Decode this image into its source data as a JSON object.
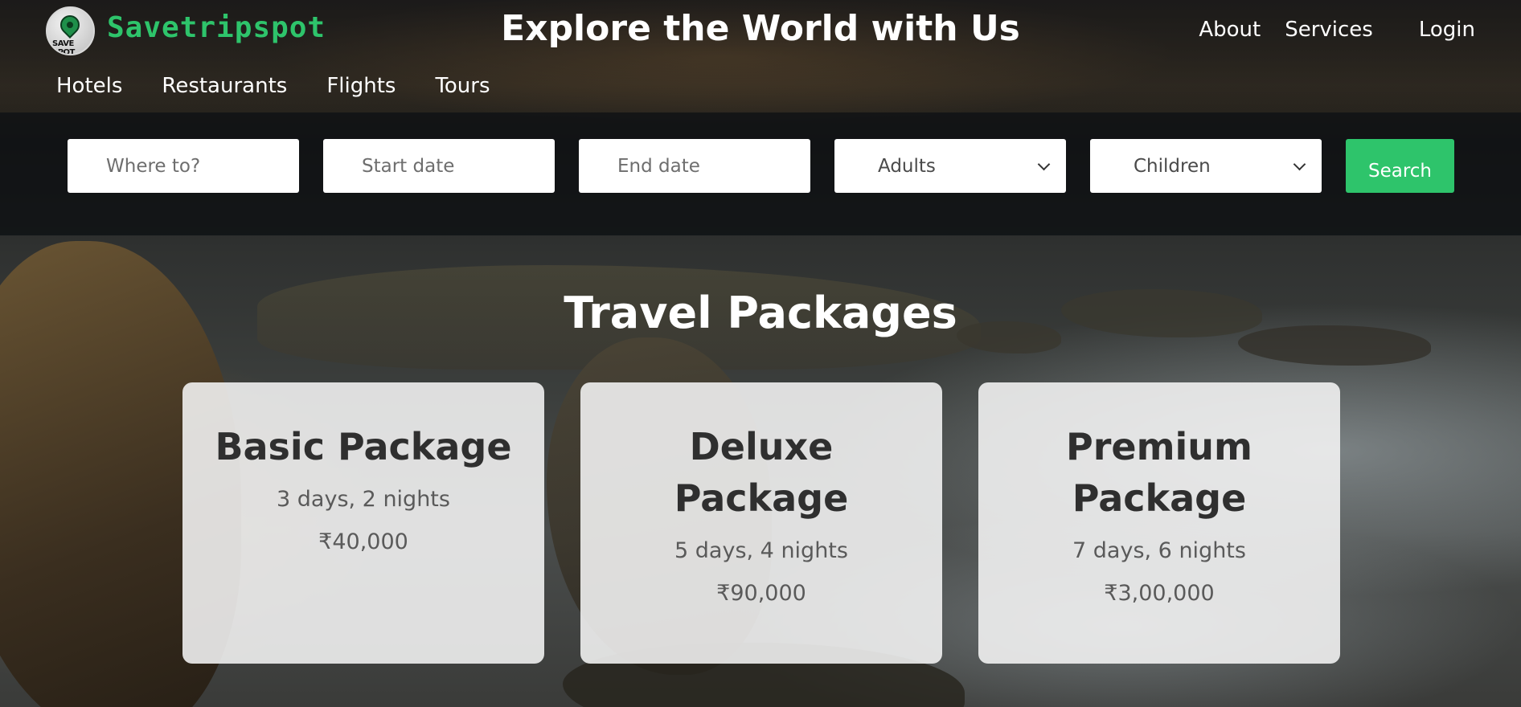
{
  "brand": {
    "name": "Savetripspot",
    "logo_text": "SAVE SPOT"
  },
  "header": {
    "title": "Explore the World with Us",
    "links": {
      "about": "About",
      "services": "Services",
      "login": "Login"
    },
    "subnav": [
      "Hotels",
      "Restaurants",
      "Flights",
      "Tours"
    ]
  },
  "search": {
    "where_placeholder": "Where to?",
    "start_placeholder": "Start date",
    "end_placeholder": "End date",
    "adults_selected": "Adults",
    "children_selected": "Children",
    "button_label": "Search",
    "button_color": "#2ec46b"
  },
  "packages": {
    "title": "Travel Packages",
    "items": [
      {
        "name": "Basic Package",
        "duration": "3 days, 2 nights",
        "price": "₹40,000"
      },
      {
        "name": "Deluxe Package",
        "duration": "5 days, 4 nights",
        "price": "₹90,000"
      },
      {
        "name": "Premium Package",
        "duration": "7 days, 6 nights",
        "price": "₹3,00,000"
      }
    ]
  },
  "colors": {
    "accent": "#2ec46b",
    "card_bg": "#f5f5f5",
    "search_band": "#0f1214"
  }
}
